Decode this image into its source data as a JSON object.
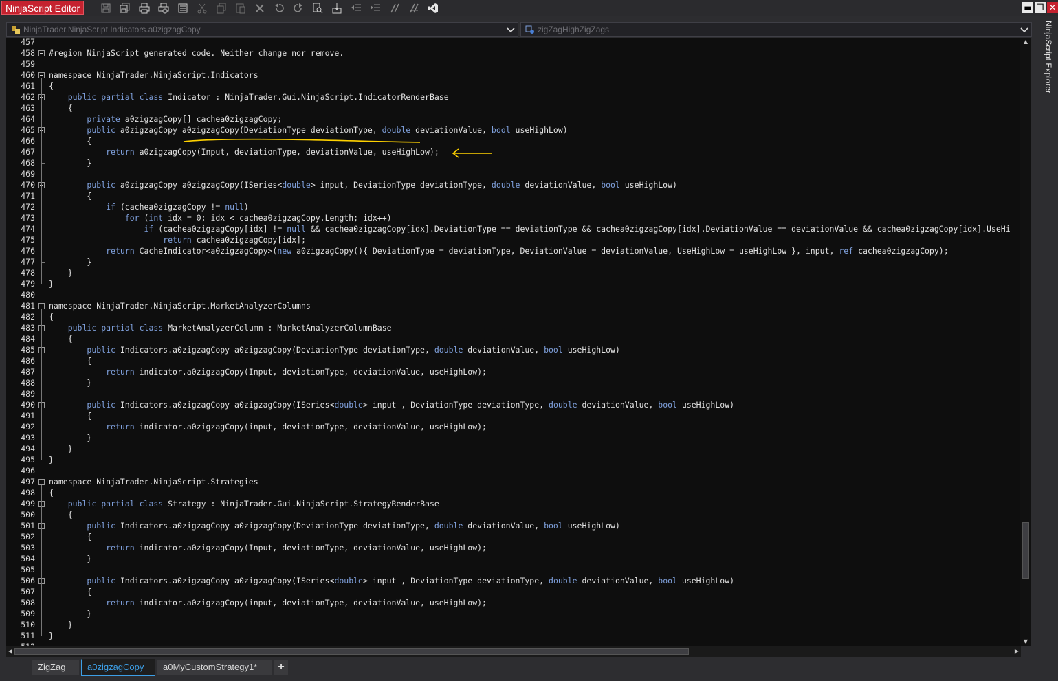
{
  "window": {
    "title": "NinjaScript Editor",
    "controls": {
      "minimize": "▬",
      "maximize": "❐",
      "close": "✕"
    }
  },
  "toolbar": {
    "buttons": [
      "save-icon",
      "save-all-icon",
      "print-icon",
      "print-preview-icon",
      "properties-icon",
      "cut-icon",
      "copy-icon",
      "paste-icon",
      "delete-icon",
      "undo-icon",
      "redo-icon",
      "find-icon",
      "compile-icon",
      "outdent-icon",
      "indent-icon",
      "comment-icon",
      "uncomment-icon",
      "visual-studio-icon"
    ]
  },
  "navigation": {
    "type_selector": "NinjaTrader.NinjaScript.Indicators.a0zigzagCopy",
    "member_selector": "zigZagHighZigZags"
  },
  "editor": {
    "first_line": 457,
    "lines": [
      "",
      "#region NinjaScript generated code. Neither change nor remove.",
      "",
      "namespace NinjaTrader.NinjaScript.Indicators",
      "{",
      "    public partial class Indicator : NinjaTrader.Gui.NinjaScript.IndicatorRenderBase",
      "    {",
      "        private a0zigzagCopy[] cachea0zigzagCopy;",
      "        public a0zigzagCopy a0zigzagCopy(DeviationType deviationType, double deviationValue, bool useHighLow)",
      "        {",
      "            return a0zigzagCopy(Input, deviationType, deviationValue, useHighLow);",
      "        }",
      "",
      "        public a0zigzagCopy a0zigzagCopy(ISeries<double> input, DeviationType deviationType, double deviationValue, bool useHighLow)",
      "        {",
      "            if (cachea0zigzagCopy != null)",
      "                for (int idx = 0; idx < cachea0zigzagCopy.Length; idx++)",
      "                    if (cachea0zigzagCopy[idx] != null && cachea0zigzagCopy[idx].DeviationType == deviationType && cachea0zigzagCopy[idx].DeviationValue == deviationValue && cachea0zigzagCopy[idx].UseHi",
      "                        return cachea0zigzagCopy[idx];",
      "            return CacheIndicator<a0zigzagCopy>(new a0zigzagCopy(){ DeviationType = deviationType, DeviationValue = deviationValue, UseHighLow = useHighLow }, input, ref cachea0zigzagCopy);",
      "        }",
      "    }",
      "}",
      "",
      "namespace NinjaTrader.NinjaScript.MarketAnalyzerColumns",
      "{",
      "    public partial class MarketAnalyzerColumn : MarketAnalyzerColumnBase",
      "    {",
      "        public Indicators.a0zigzagCopy a0zigzagCopy(DeviationType deviationType, double deviationValue, bool useHighLow)",
      "        {",
      "            return indicator.a0zigzagCopy(Input, deviationType, deviationValue, useHighLow);",
      "        }",
      "",
      "        public Indicators.a0zigzagCopy a0zigzagCopy(ISeries<double> input , DeviationType deviationType, double deviationValue, bool useHighLow)",
      "        {",
      "            return indicator.a0zigzagCopy(input, deviationType, deviationValue, useHighLow);",
      "        }",
      "    }",
      "}",
      "",
      "namespace NinjaTrader.NinjaScript.Strategies",
      "{",
      "    public partial class Strategy : NinjaTrader.Gui.NinjaScript.StrategyRenderBase",
      "    {",
      "        public Indicators.a0zigzagCopy a0zigzagCopy(DeviationType deviationType, double deviationValue, bool useHighLow)",
      "        {",
      "            return indicator.a0zigzagCopy(Input, deviationType, deviationValue, useHighLow);",
      "        }",
      "",
      "        public Indicators.a0zigzagCopy a0zigzagCopy(ISeries<double> input , DeviationType deviationType, double deviationValue, bool useHighLow)",
      "        {",
      "            return indicator.a0zigzagCopy(input, deviationType, deviationValue, useHighLow);",
      "        }",
      "    }",
      "}",
      "",
      ""
    ],
    "fold_markers_at_lines": [
      458,
      460,
      462,
      465,
      470,
      481,
      483,
      485,
      490,
      497,
      499,
      501,
      506
    ],
    "keywords": [
      "public",
      "partial",
      "class",
      "private",
      "double",
      "bool",
      "return",
      "if",
      "for",
      "int",
      "null",
      "new",
      "ref",
      "double>"
    ]
  },
  "explorer": {
    "label": "NinjaScript Explorer"
  },
  "tabs": [
    {
      "label": "ZigZag",
      "active": false
    },
    {
      "label": "a0zigzagCopy",
      "active": true
    },
    {
      "label": "a0MyCustomStrategy1*",
      "active": false
    },
    {
      "label": "+",
      "active": false
    }
  ],
  "colors": {
    "title_bg": "#c5222f",
    "keyword": "#7fa0dc",
    "annotation": "#ffd200",
    "active_tab": "#3d9fe6"
  }
}
